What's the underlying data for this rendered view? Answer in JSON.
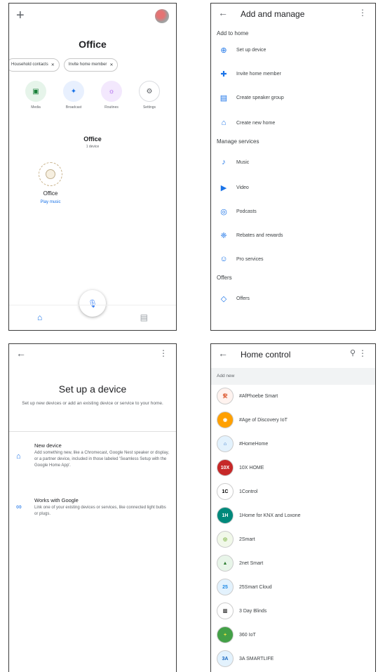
{
  "home": {
    "title": "Office",
    "chips": [
      {
        "label": "Household contacts"
      },
      {
        "label": "Invite home member"
      }
    ],
    "quick_actions": [
      {
        "label": "Media",
        "glyph": "▣",
        "bg": "#e6f4ea",
        "fg": "#188038"
      },
      {
        "label": "Broadcast",
        "glyph": "✦",
        "bg": "#e8f0fe",
        "fg": "#1a73e8"
      },
      {
        "label": "Routines",
        "glyph": "☼",
        "bg": "#f3e8fd",
        "fg": "#9334e6"
      },
      {
        "label": "Settings",
        "glyph": "⚙",
        "bg": "#ffffff",
        "fg": "#5f6368"
      }
    ],
    "room": {
      "title": "Office",
      "subtitle": "1 device"
    },
    "device": {
      "name": "Office",
      "action": "Play music"
    }
  },
  "add_manage": {
    "title": "Add and manage",
    "sections": {
      "add": "Add to home",
      "manage": "Manage services",
      "offers": "Offers"
    },
    "add_items": [
      {
        "label": "Set up device",
        "icon": "⊕",
        "color": "#1a73e8"
      },
      {
        "label": "Invite home member",
        "icon": "✚",
        "color": "#1a73e8"
      },
      {
        "label": "Create speaker group",
        "icon": "▤",
        "color": "#1a73e8"
      },
      {
        "label": "Create new home",
        "icon": "⌂",
        "color": "#1a73e8"
      }
    ],
    "manage_items": [
      {
        "label": "Music",
        "icon": "♪",
        "color": "#1a73e8"
      },
      {
        "label": "Video",
        "icon": "▶",
        "color": "#1a73e8"
      },
      {
        "label": "Podcasts",
        "icon": "◎",
        "color": "#1a73e8"
      },
      {
        "label": "Rebates and rewards",
        "icon": "❈",
        "color": "#1a73e8"
      },
      {
        "label": "Pro services",
        "icon": "☺",
        "color": "#1a73e8"
      }
    ],
    "offers_items": [
      {
        "label": "Offers",
        "icon": "◇",
        "color": "#1a73e8"
      }
    ]
  },
  "setup": {
    "title": "Set up a device",
    "subtitle": "Set up new devices or add an existing device or service to your home.",
    "options": [
      {
        "title": "New device",
        "desc": "Add something new, like a Chromecast, Google Nest speaker or display, or a partner device, included in those labeled 'Seamless Setup with the Google Home App'.",
        "icon": "⌂"
      },
      {
        "title": "Works with Google",
        "desc": "Link one of your existing devices or services, like connected light bulbs or plugs.",
        "icon": "∞"
      }
    ]
  },
  "home_control": {
    "title": "Home control",
    "add_new": "Add new",
    "brands": [
      {
        "name": "#AfPhoebe Smart",
        "logo": "安",
        "bg": "#fff3ef",
        "fg": "#d84315"
      },
      {
        "name": "#Age of Discovery IoT",
        "logo": "◉",
        "bg": "#ffa000",
        "fg": "#ffffff"
      },
      {
        "name": "#HomeHome",
        "logo": "⌂",
        "bg": "#e3f2fd",
        "fg": "#1565c0"
      },
      {
        "name": "10X HOME",
        "logo": "10X",
        "bg": "#c62828",
        "fg": "#ffffff"
      },
      {
        "name": "1Control",
        "logo": "1C",
        "bg": "#ffffff",
        "fg": "#000000"
      },
      {
        "name": "1Home for KNX and Loxone",
        "logo": "1H",
        "bg": "#00897b",
        "fg": "#ffffff"
      },
      {
        "name": "2Smart",
        "logo": "◎",
        "bg": "#f1f8e9",
        "fg": "#7cb342"
      },
      {
        "name": "2net Smart",
        "logo": "▲",
        "bg": "#e8f5e9",
        "fg": "#2e7d32"
      },
      {
        "name": "25Smart Cloud",
        "logo": "25",
        "bg": "#e3f2fd",
        "fg": "#1e88e5"
      },
      {
        "name": "3 Day Blinds",
        "logo": "▥",
        "bg": "#ffffff",
        "fg": "#424242"
      },
      {
        "name": "360 IoT",
        "logo": "+",
        "bg": "#43a047",
        "fg": "#ffeb3b"
      },
      {
        "name": "3A SMARTLIFE",
        "logo": "3A",
        "bg": "#e3f2fd",
        "fg": "#1565c0"
      }
    ]
  }
}
